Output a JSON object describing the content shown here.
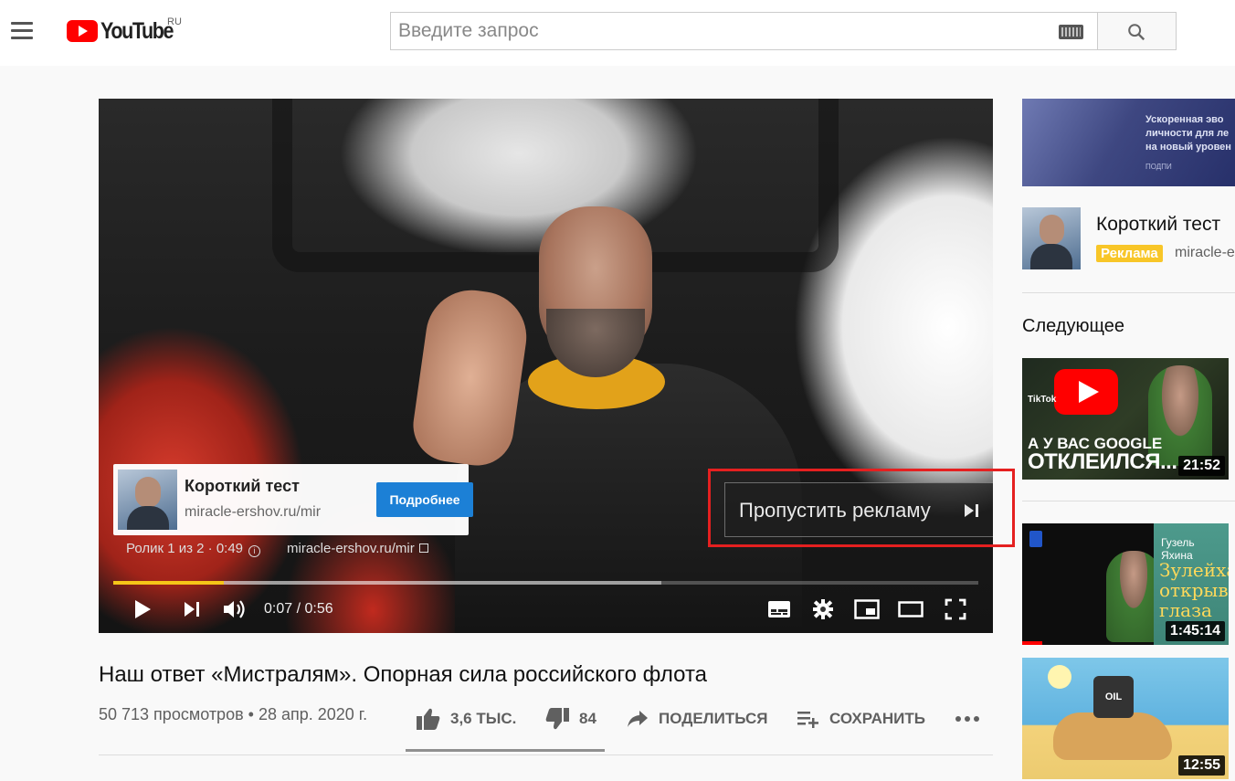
{
  "header": {
    "logo_text": "YouTube",
    "logo_region": "RU",
    "search_placeholder": "Введите запрос"
  },
  "player": {
    "ad_card": {
      "title": "Короткий тест",
      "url": "miracle-ershov.ru/mir",
      "button_label": "Подробнее"
    },
    "ad_info": "Ролик 1 из 2 · 0:49",
    "ad_info_link": "miracle-ershov.ru/mir",
    "skip_label": "Пропустить рекламу",
    "time": "0:07 / 0:56",
    "progress_played_fraction": 0.128,
    "progress_buffered_fraction": 0.634
  },
  "video": {
    "title": "Наш ответ «Мистралям». Опорная сила российского флота",
    "views_date": "50 713 просмотров • 28 апр. 2020 г.",
    "like_count": "3,6 ТЫС.",
    "dislike_count": "84",
    "share_label": "ПОДЕЛИТЬСЯ",
    "save_label": "СОХРАНИТЬ"
  },
  "sidebar": {
    "banner_text": "Ускоренная эво личности для ле на новый уровен",
    "banner_small": "ПОДПИ",
    "ad_title": "Короткий тест",
    "ad_badge": "Реклама",
    "ad_url": "miracle-e",
    "next_label": "Следующее",
    "recommendations": [
      {
        "line1": "А У ВАС GOOGLE",
        "line2": "ОТКЛЕИЛСЯ...",
        "duration": "21:52",
        "tag": "TikTok"
      },
      {
        "book_title": "Гузель Яхина",
        "book_big": "Зулейха открывает глаза",
        "duration": "1:45:14"
      },
      {
        "barrel_text": "OIL",
        "duration": "12:55"
      }
    ]
  }
}
